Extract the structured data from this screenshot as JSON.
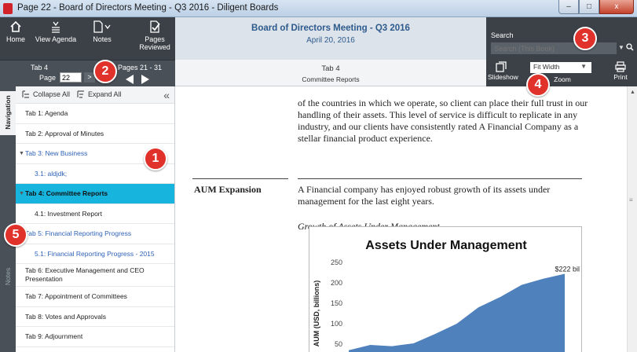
{
  "window": {
    "title": "Page 22 - Board of Directors Meeting - Q3 2016 - Diligent Boards",
    "minimize": "–",
    "maximize": "□",
    "close": "x"
  },
  "toolbar": {
    "home": "Home",
    "view_agenda": "View Agenda",
    "notes": "Notes",
    "pages_reviewed": "Pages Reviewed"
  },
  "pagebar": {
    "tab_label": "Tab 4",
    "page_label": "Page",
    "page_value": "22",
    "go_arrow": ">",
    "pages_range": "Pages 21 - 31"
  },
  "header": {
    "meeting_title": "Board of Directors Meeting - Q3 2016",
    "meeting_date": "April 20, 2016",
    "current_tab": "Tab 4",
    "current_section": "Committee Reports"
  },
  "search": {
    "label": "Search",
    "placeholder": "Search (This Book)"
  },
  "tools": {
    "slideshow": "Slideshow",
    "zoom_value": "Fit Width",
    "zoom_label": "Zoom",
    "print": "Print"
  },
  "sidetabs": {
    "navigation": "Navigation",
    "notes": "Notes"
  },
  "nav": {
    "collapse_all": "Collapse All",
    "expand_all": "Expand All",
    "items": [
      {
        "label": "Tab 1: Agenda"
      },
      {
        "label": "Tab 2: Approval of Minutes"
      },
      {
        "label": "Tab 3: New Business"
      },
      {
        "label": "3.1: aldjdk;"
      },
      {
        "label": "Tab 4: Committee Reports"
      },
      {
        "label": "4.1: Investment Report"
      },
      {
        "label": "Tab 5: Financial Reporting Progress"
      },
      {
        "label": "5.1: Financial Reporting Progress - 2015"
      },
      {
        "label": "Tab 6: Executive Management and CEO Presentation"
      },
      {
        "label": "Tab 7: Appointment of Committees"
      },
      {
        "label": "Tab 8: Votes and Approvals"
      },
      {
        "label": "Tab 9: Adjournment"
      }
    ]
  },
  "document": {
    "para1": "of the countries in which we operate, so client can place their full trust in our handling of their assets. This level of service is difficult to replicate in any industry, and our clients have consistently rated A Financial Company as a stellar financial product experience.",
    "section_heading": "AUM Expansion",
    "para2": "A Financial company has enjoyed robust growth of its assets under management for the last eight years.",
    "caption": "Growth of Assets Under Management"
  },
  "callouts": [
    "1",
    "2",
    "3",
    "4",
    "5"
  ],
  "colors": {
    "accent": "#17b4de",
    "callout": "#e0312a",
    "area_fill": "#4f81bd"
  },
  "chart_data": {
    "type": "area",
    "title": "Assets Under Management",
    "ylabel": "AUM (USD, billions)",
    "ylim": [
      0,
      250
    ],
    "yticks": [
      50,
      100,
      150,
      200,
      250
    ],
    "x": [
      0,
      1,
      2,
      3,
      4,
      5,
      6,
      7,
      8,
      9,
      10
    ],
    "values": [
      35,
      48,
      45,
      52,
      75,
      100,
      140,
      165,
      195,
      210,
      222
    ],
    "annotation": "$222 bil"
  }
}
